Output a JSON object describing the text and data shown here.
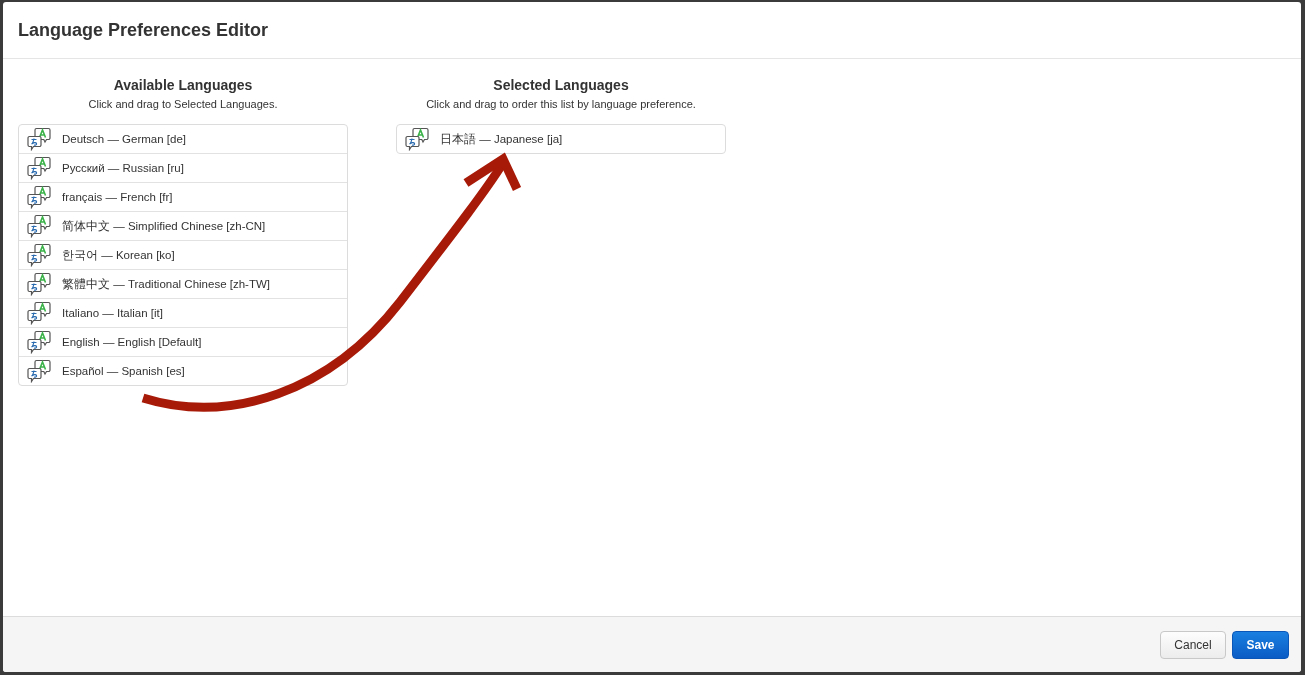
{
  "dialog": {
    "title": "Language Preferences Editor"
  },
  "columns": [
    {
      "heading": "Available Languages",
      "hint": "Click and drag to Selected Languages.",
      "items": [
        {
          "label": "Deutsch — German [de]"
        },
        {
          "label": "Русский — Russian [ru]"
        },
        {
          "label": "français — French [fr]"
        },
        {
          "label": "简体中文 — Simplified Chinese [zh-CN]"
        },
        {
          "label": "한국어 — Korean [ko]"
        },
        {
          "label": "繁體中文 — Traditional Chinese [zh-TW]"
        },
        {
          "label": "Italiano — Italian [it]"
        },
        {
          "label": "English — English [Default]"
        },
        {
          "label": "Español — Spanish [es]"
        }
      ]
    },
    {
      "heading": "Selected Languages",
      "hint": "Click and drag to order this list by language preference.",
      "items": [
        {
          "label": "日本語 — Japanese [ja]"
        }
      ]
    }
  ],
  "buttons": [
    {
      "label": "Cancel",
      "kind": "secondary"
    },
    {
      "label": "Save",
      "kind": "primary"
    }
  ]
}
